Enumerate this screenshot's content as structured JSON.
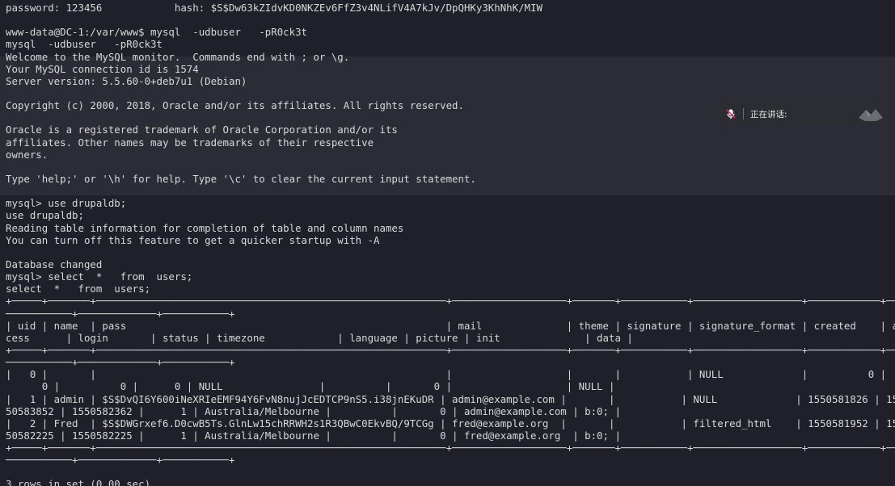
{
  "terminal": {
    "lines": [
      "password: 123456            hash: $S$Dw63kZIdvKD0NKZEv6FfZ3v4NLifV4A7kJv/DpQHKy3KhNhK/MIW",
      "",
      "www-data@DC-1:/var/www$ mysql  -udbuser   -pR0ck3t",
      "mysql  -udbuser   -pR0ck3t",
      "Welcome to the MySQL monitor.  Commands end with ; or \\g.",
      "Your MySQL connection id is 1574",
      "Server version: 5.5.60-0+deb7u1 (Debian)",
      "",
      "Copyright (c) 2000, 2018, Oracle and/or its affiliates. All rights reserved.",
      "",
      "Oracle is a registered trademark of Oracle Corporation and/or its",
      "affiliates. Other names may be trademarks of their respective",
      "owners.",
      "",
      "Type 'help;' or '\\h' for help. Type '\\c' to clear the current input statement.",
      "",
      "mysql> use drupaldb;",
      "use drupaldb;",
      "Reading table information for completion of table and column names",
      "You can turn off this feature to get a quicker startup with -A",
      "",
      "Database changed",
      "mysql> select  *   from  users;",
      "select  *   from  users;",
      "+─────+───────+──────────────────────────────────────────────────────────+───────────────────+───────+───────────+──────────────────+────────────+───",
      "───────────+─────────────+───────────+",
      "| uid | name  | pass                                                     | mail              | theme | signature | signature_format | created    | ac",
      "cess      | login       | status | timezone            | language | picture | init              | data |",
      "+─────+───────+──────────────────────────────────────────────────────────+───────────────────+───────+───────────+──────────────────+────────────+───",
      "───────────+─────────────+───────────+",
      "|   0 |       |                                                          |                   |       |           | NULL             |          0 |",
      "      0 |          0 |      0 | NULL                |          |       0 |                   | NULL |",
      "|   1 | admin | $S$DvQI6Y600iNeXRIeEMF94Y6FvN8nujJcEDTCP9nS5.i38jnEKuDR | admin@example.com |       |           | NULL             | 1550581826 | 15",
      "50583852 | 1550582362 |      1 | Australia/Melbourne |          |       0 | admin@example.com | b:0; |",
      "|   2 | Fred  | $S$DWGrxef6.D0cwB5Ts.GlnLw15chRRWH2s1R3QBwC0EkvBQ/9TCGg | fred@example.org  |       |           | filtered_html    | 1550581952 | 15",
      "50582225 | 1550582225 |      1 | Australia/Melbourne |          |       0 | fred@example.org  | b:0; |",
      "+─────+───────+──────────────────────────────────────────────────────────+───────────────────+───────+───────────+──────────────────+────────────+───",
      "───────────+─────────────+───────────+",
      "",
      "3 rows in set (0.00 sec)"
    ]
  },
  "overlay": {
    "speaking_label": "正在讲话:",
    "mic_icon": "mic-slash-icon",
    "logo_icon": "app-logo-icon",
    "accent": "#ffffff"
  }
}
